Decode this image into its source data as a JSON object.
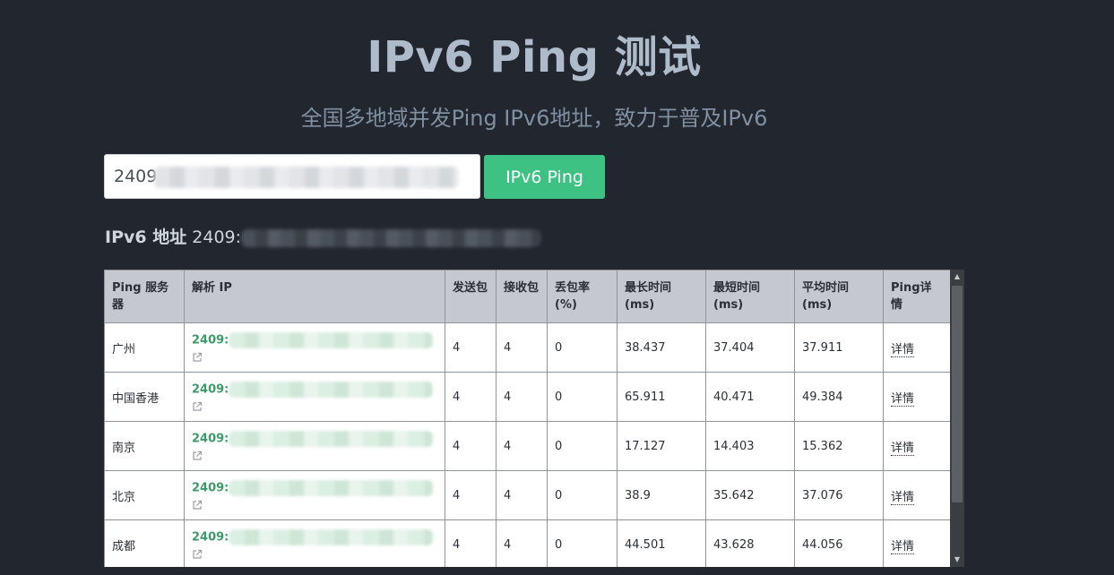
{
  "header": {
    "title": "IPv6 Ping 测试",
    "subtitle": "全国多地域并发Ping IPv6地址，致力于普及IPv6"
  },
  "search": {
    "value": "2409",
    "button_label": "IPv6 Ping"
  },
  "address": {
    "label": "IPv6 地址",
    "value_prefix": "2409:"
  },
  "table": {
    "headers": [
      "Ping 服务器",
      "解析 IP",
      "发送包",
      "接收包",
      "丢包率(%)",
      "最长时间(ms)",
      "最短时间(ms)",
      "平均时间(ms)",
      "Ping详情"
    ],
    "rows": [
      {
        "server": "广州",
        "ip_prefix": "2409:",
        "sent": "4",
        "received": "4",
        "loss": "0",
        "max": "38.437",
        "min": "37.404",
        "avg": "37.911",
        "detail": "详情"
      },
      {
        "server": "中国香港",
        "ip_prefix": "2409:",
        "sent": "4",
        "received": "4",
        "loss": "0",
        "max": "65.911",
        "min": "40.471",
        "avg": "49.384",
        "detail": "详情"
      },
      {
        "server": "南京",
        "ip_prefix": "2409:",
        "sent": "4",
        "received": "4",
        "loss": "0",
        "max": "17.127",
        "min": "14.403",
        "avg": "15.362",
        "detail": "详情"
      },
      {
        "server": "北京",
        "ip_prefix": "2409:",
        "sent": "4",
        "received": "4",
        "loss": "0",
        "max": "38.9",
        "min": "35.642",
        "avg": "37.076",
        "detail": "详情"
      },
      {
        "server": "成都",
        "ip_prefix": "2409:",
        "sent": "4",
        "received": "4",
        "loss": "0",
        "max": "44.501",
        "min": "43.628",
        "avg": "44.056",
        "detail": "详情"
      }
    ]
  },
  "icons": {
    "external_link": "external-link-icon",
    "scroll_up": "scroll-up-arrow-icon",
    "scroll_down": "scroll-down-arrow-icon"
  },
  "colors": {
    "background": "#22262e",
    "accent": "#3dc284",
    "ip_link": "#3d9a6a",
    "header_bg": "#c5c8ce"
  }
}
